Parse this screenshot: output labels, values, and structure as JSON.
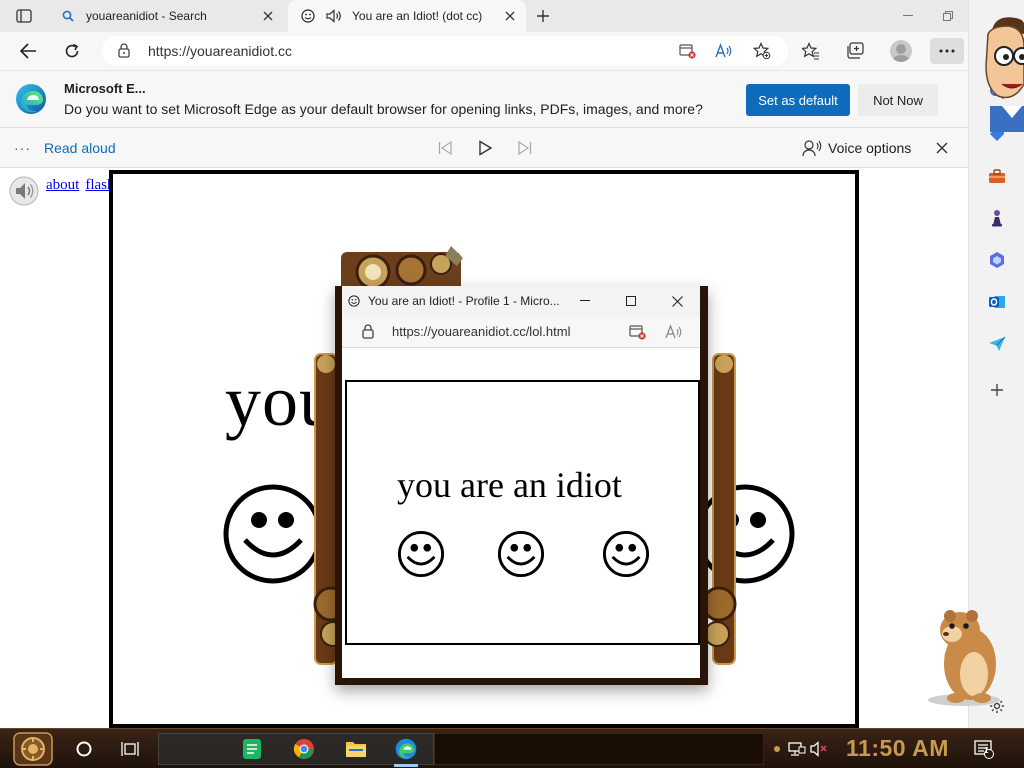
{
  "tabs": [
    {
      "title": "youareanidiot - Search",
      "favicon": "search-icon"
    },
    {
      "title": "You are an Idiot! (dot cc)",
      "favicon": "smiley-icon"
    }
  ],
  "address": {
    "url": "https://youareanidiot.cc"
  },
  "infobar": {
    "title": "Microsoft E...",
    "message": "Do you want to set Microsoft Edge as your default browser for opening links, PDFs, images, and more?",
    "primary_label": "Set as default",
    "secondary_label": "Not Now"
  },
  "read_aloud": {
    "dots": "···",
    "label": "Read aloud",
    "voice_label": "Voice options"
  },
  "page": {
    "links": [
      "about",
      "flash"
    ],
    "big_text": "you are an idiot"
  },
  "popup": {
    "title": "You are an Idiot! - Profile 1 - Micro...",
    "url": "https://youareanidiot.cc/lol.html",
    "text": "you are an idiot"
  },
  "taskbar": {
    "clock": "11:50 AM",
    "notification_count": "1"
  },
  "colors": {
    "accent": "#0f6cbd",
    "taskbar": "#2a170c",
    "clock": "#c89a4e"
  }
}
